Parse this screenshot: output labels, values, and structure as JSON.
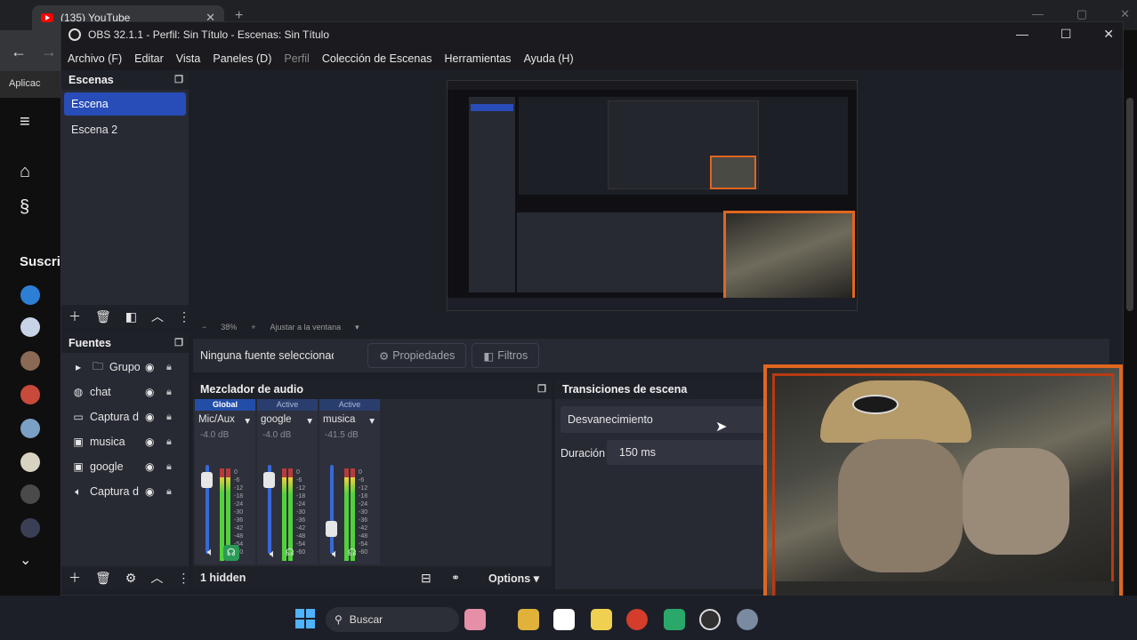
{
  "browser": {
    "tab_title": "(135) YouTube",
    "new_tab": "+",
    "tab_close": "✕",
    "back": "←",
    "forward": "→",
    "bookmark_apps": "Aplicac",
    "win_min": "—",
    "win_max": "▢",
    "win_close": "✕"
  },
  "youtube": {
    "menu_icon": "≡",
    "home_icon": "⌂",
    "shorts_icon": "§",
    "subscriptions_label": "Suscrip",
    "more_icon": "⌄"
  },
  "obs": {
    "title": "OBS 32.1.1 - Perfil: Sin Título - Escenas: Sin Título",
    "win_min": "—",
    "win_max": "☐",
    "win_close": "✕",
    "menu": [
      "Archivo (F)",
      "Editar",
      "Vista",
      "Paneles (D)",
      "Perfil",
      "Colección de Escenas",
      "Herramientas",
      "Ayuda (H)"
    ],
    "scenes": {
      "title": "Escenas",
      "items": [
        "Escena",
        "Escena 2"
      ]
    },
    "sources": {
      "title": "Fuentes",
      "items": [
        {
          "name": "Grupo",
          "icon": "folder-icon"
        },
        {
          "name": "chat",
          "icon": "browser-icon"
        },
        {
          "name": "Captura d",
          "icon": "display-icon"
        },
        {
          "name": "musica",
          "icon": "media-icon"
        },
        {
          "name": "google",
          "icon": "media-icon"
        },
        {
          "name": "Captura d",
          "icon": "audio-icon"
        }
      ]
    },
    "preview": {
      "zoom_minus": "−",
      "zoom": "38%",
      "zoom_plus": "+",
      "fit_label": "Ajustar a la ventana"
    },
    "properties_bar": {
      "no_source": "Ninguna fuente seleccionada",
      "properties": "Propiedades",
      "filters": "Filtros"
    },
    "mixer": {
      "title": "Mezclador de audio",
      "channels": [
        {
          "tag": "Global",
          "name": "Mic/Aux",
          "db": "-4.0 dB",
          "level": 0.92,
          "fader": 0.9
        },
        {
          "tag": "Active",
          "name": "google",
          "db": "-4.0 dB",
          "level": 0.9,
          "fader": 0.9
        },
        {
          "tag": "Active",
          "name": "musica",
          "db": "-41.5 dB",
          "level": 0.9,
          "fader": 0.35
        }
      ],
      "ticks": [
        "0",
        "-6",
        "-12",
        "-18",
        "-24",
        "-30",
        "-36",
        "-42",
        "-48",
        "-54",
        "-60"
      ],
      "hidden_label": "1 hidden",
      "options_label": "Options"
    },
    "transitions": {
      "title": "Transiciones de escena",
      "selected": "Desvanecimiento",
      "duration_label": "Duración",
      "duration_value": "150 ms"
    }
  },
  "taskbar": {
    "search_label": "Buscar"
  },
  "colors": {
    "accent": "#284cb8",
    "webcam_border": "#e0661f"
  }
}
